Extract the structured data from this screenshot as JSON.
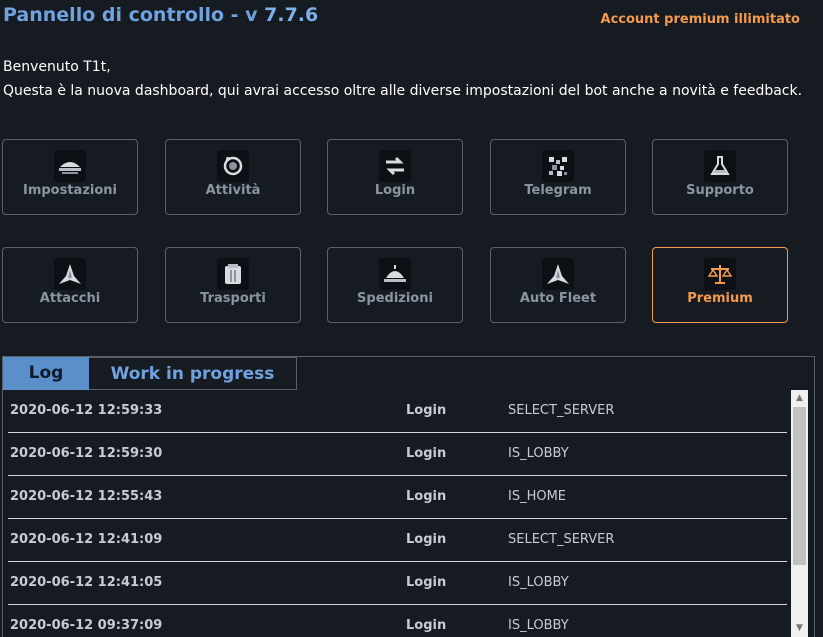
{
  "header": {
    "title": "Pannello di controllo - v ",
    "version": "7.7.6",
    "account_status": "Account premium illimitato"
  },
  "welcome": {
    "line1": "Benvenuto T1t,",
    "line2": "Questa è la nuova dashboard, qui avrai accesso oltre alle diverse impostazioni del bot anche a novità e feedback."
  },
  "tiles": [
    {
      "label": "Impostazioni",
      "icon": "settings-ship-icon"
    },
    {
      "label": "Attività",
      "icon": "planet-icon"
    },
    {
      "label": "Login",
      "icon": "refresh-arrows-icon"
    },
    {
      "label": "Telegram",
      "icon": "telegram-icon"
    },
    {
      "label": "Supporto",
      "icon": "flask-icon"
    },
    {
      "label": "Attacchi",
      "icon": "fighter-ship-icon"
    },
    {
      "label": "Trasporti",
      "icon": "cargo-icon"
    },
    {
      "label": "Spedizioni",
      "icon": "expedition-ship-icon"
    },
    {
      "label": "Auto Fleet",
      "icon": "fleet-icon"
    },
    {
      "label": "Premium",
      "icon": "balance-scale-icon"
    }
  ],
  "tabs": {
    "log": "Log",
    "wip": "Work in progress"
  },
  "log_rows": [
    {
      "time": "2020-06-12 12:59:33",
      "category": "Login",
      "value": "SELECT_SERVER"
    },
    {
      "time": "2020-06-12 12:59:30",
      "category": "Login",
      "value": "IS_LOBBY"
    },
    {
      "time": "2020-06-12 12:55:43",
      "category": "Login",
      "value": "IS_HOME"
    },
    {
      "time": "2020-06-12 12:41:09",
      "category": "Login",
      "value": "SELECT_SERVER"
    },
    {
      "time": "2020-06-12 12:41:05",
      "category": "Login",
      "value": "IS_LOBBY"
    },
    {
      "time": "2020-06-12 09:37:09",
      "category": "Login",
      "value": "IS_LOBBY"
    }
  ],
  "colors": {
    "background": "#161b22",
    "accent_blue": "#6fa3df",
    "accent_orange": "#f39a4d"
  }
}
